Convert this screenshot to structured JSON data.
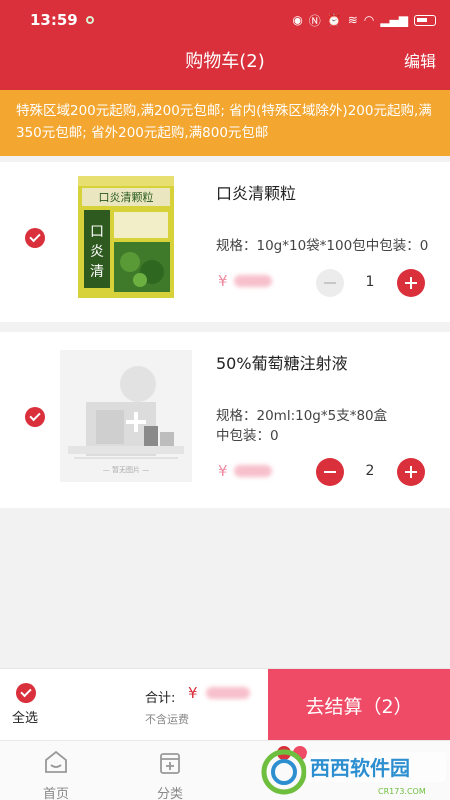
{
  "status_bar": {
    "time": "13:59"
  },
  "header": {
    "title": "购物车(2)",
    "edit_label": "编辑"
  },
  "notice": {
    "text": "特殊区域200元起购,满200元包邮; 省内(特殊区域除外)200元起购,满350元包邮; 省外200元起购,满800元包邮"
  },
  "cart_items": [
    {
      "name": "口炎清颗粒",
      "spec_lines": [
        "规格：10g*10袋*100包中包装：0"
      ],
      "currency": "¥",
      "quantity": "1",
      "package_text": "口炎清颗粒"
    },
    {
      "name": "50%葡萄糖注射液",
      "spec_lines": [
        "规格：20ml:10g*5支*80盒",
        "中包装：0"
      ],
      "currency": "¥",
      "quantity": "2",
      "placeholder_caption": "— 暂无图片 —"
    }
  ],
  "checkout": {
    "select_all_label": "全选",
    "total_label": "合计:",
    "currency": "¥",
    "shipping_note": "不含运费",
    "button_label": "去结算（2）"
  },
  "tabbar": {
    "items": [
      {
        "label": "首页"
      },
      {
        "label": "分类"
      }
    ]
  },
  "watermark": {
    "text": "西西软件园",
    "sub": "CR173.COM"
  },
  "colors": {
    "brand_red": "#d9303b",
    "notice_orange": "#f3a630",
    "checkout_pink": "#ef4a66"
  }
}
